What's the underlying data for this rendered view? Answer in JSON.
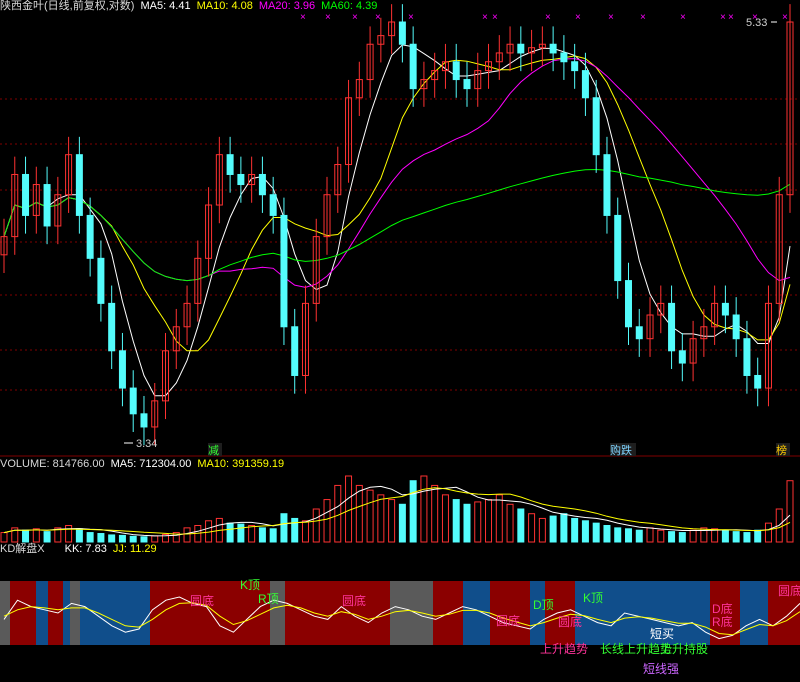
{
  "colors": {
    "up": "#ff3232",
    "down": "#54fcfc",
    "bg": "#000000",
    "grid": "#800000",
    "white": "#ffffff",
    "yellow": "#ffff00",
    "magenta": "#ff00ff",
    "green": "#00ff00",
    "kd_red": "#8b0000",
    "kd_blue": "#104e8b",
    "kd_gray": "#5a5a5a",
    "kd_yellow": "#ffff00",
    "label_pink": "#ff3399",
    "label_green": "#33ff33",
    "label_violet": "#cc66ff"
  },
  "price_panel": {
    "title": "陕西金叶(日线,前复权,对数)",
    "ma5": "MA5: 4.41",
    "ma10": "MA10: 4.08",
    "ma20": "MA20: 3.96",
    "ma60": "MA60: 4.39",
    "high_label": "5.33",
    "low_label": "3.34",
    "signals": [
      "减",
      "购跌",
      "榜"
    ]
  },
  "volume_panel": {
    "title": "VOLUME: 814766.00",
    "ma5": "MA5: 712304.00",
    "ma10": "MA10: 391359.19"
  },
  "kd_panel": {
    "title": "KD解盘X",
    "kk": "KK: 7.83",
    "jj": "JJ: 11.29",
    "labels": [
      {
        "text": "圆底",
        "color": "label_pink"
      },
      {
        "text": "K顶",
        "color": "label_green"
      },
      {
        "text": "R顶",
        "color": "label_green"
      },
      {
        "text": "圆底",
        "color": "label_pink"
      },
      {
        "text": "D顶",
        "color": "label_green"
      },
      {
        "text": "圆底",
        "color": "label_pink"
      },
      {
        "text": "圆底",
        "color": "label_pink"
      },
      {
        "text": "K顶",
        "color": "label_green"
      },
      {
        "text": "上升趋势",
        "color": "label_pink"
      },
      {
        "text": "长线上升趋势",
        "color": "label_green"
      },
      {
        "text": "上升持股",
        "color": "label_green"
      },
      {
        "text": "短买",
        "color": "label_white"
      },
      {
        "text": "短线强",
        "color": "label_violet"
      },
      {
        "text": "D底",
        "color": "label_pink"
      },
      {
        "text": "R底",
        "color": "label_pink"
      },
      {
        "text": "圆底",
        "color": "label_pink"
      }
    ]
  },
  "chart_data": {
    "type": "candlestick",
    "scale": "log",
    "note_values": "approximate, read from the picture",
    "high": 5.33,
    "low": 3.34,
    "close_series": [
      4.2,
      4.5,
      4.3,
      4.45,
      4.25,
      4.4,
      4.6,
      4.3,
      4.1,
      3.9,
      3.7,
      3.55,
      3.45,
      3.4,
      3.5,
      3.7,
      3.8,
      3.9,
      4.1,
      4.35,
      4.6,
      4.5,
      4.45,
      4.5,
      4.4,
      4.3,
      3.8,
      3.6,
      3.9,
      4.2,
      4.4,
      4.55,
      4.9,
      5.0,
      5.2,
      5.25,
      5.33,
      5.2,
      4.95,
      5.0,
      5.05,
      5.1,
      5.0,
      4.95,
      5.05,
      5.1,
      5.15,
      5.2,
      5.15,
      5.18,
      5.2,
      5.15,
      5.1,
      5.05,
      4.9,
      4.6,
      4.3,
      4.0,
      3.8,
      3.75,
      3.85,
      3.9,
      3.7,
      3.65,
      3.75,
      3.8,
      3.9,
      3.85,
      3.75,
      3.6,
      3.55,
      3.9,
      4.4,
      5.33
    ],
    "volume_series": [
      20,
      30,
      25,
      28,
      22,
      30,
      35,
      28,
      20,
      18,
      15,
      14,
      12,
      11,
      13,
      16,
      20,
      30,
      35,
      45,
      50,
      40,
      38,
      35,
      30,
      28,
      60,
      50,
      45,
      70,
      90,
      120,
      140,
      120,
      110,
      100,
      90,
      80,
      130,
      140,
      120,
      100,
      90,
      80,
      85,
      90,
      100,
      80,
      70,
      60,
      50,
      55,
      60,
      50,
      45,
      40,
      35,
      30,
      28,
      25,
      30,
      25,
      22,
      20,
      25,
      30,
      28,
      25,
      22,
      20,
      25,
      40,
      70,
      130
    ],
    "kd_k": [
      40,
      70,
      60,
      55,
      50,
      65,
      60,
      45,
      30,
      20,
      25,
      55,
      70,
      75,
      65,
      60,
      30,
      20,
      40,
      60,
      70,
      65,
      55,
      45,
      40,
      60,
      45,
      35,
      50,
      60,
      55,
      45,
      40,
      50,
      60,
      55,
      45,
      35,
      30,
      25,
      40,
      50,
      55,
      45,
      35,
      30,
      50,
      45,
      40,
      35,
      30,
      35,
      20,
      10,
      15,
      30,
      40,
      30,
      45,
      65
    ],
    "kd_d": [
      45,
      55,
      60,
      58,
      55,
      58,
      58,
      50,
      40,
      30,
      28,
      40,
      55,
      65,
      66,
      62,
      45,
      32,
      38,
      48,
      58,
      62,
      58,
      50,
      45,
      52,
      48,
      40,
      45,
      52,
      54,
      50,
      45,
      48,
      54,
      54,
      50,
      42,
      36,
      30,
      35,
      42,
      48,
      46,
      40,
      35,
      42,
      44,
      42,
      38,
      34,
      34,
      28,
      18,
      16,
      24,
      32,
      30,
      38,
      52
    ]
  }
}
